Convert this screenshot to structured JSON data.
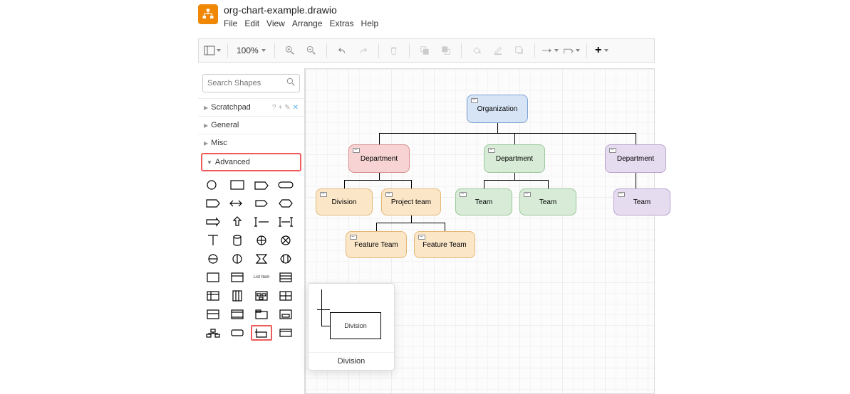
{
  "app": {
    "title": "org-chart-example.drawio"
  },
  "menu": {
    "items": [
      "File",
      "Edit",
      "View",
      "Arrange",
      "Extras",
      "Help"
    ]
  },
  "toolbar": {
    "zoom": "100%"
  },
  "search": {
    "placeholder": "Search Shapes"
  },
  "sections": {
    "scratchpad": "Scratchpad",
    "general": "General",
    "misc": "Misc",
    "advanced": "Advanced"
  },
  "nodes": {
    "org": "Organization",
    "dept1": "Department",
    "dept2": "Department",
    "dept3": "Department",
    "div": "Division",
    "proj": "Project team",
    "team1": "Team",
    "team2": "Team",
    "team3": "Team",
    "ft1": "Feature Team",
    "ft2": "Feature Team"
  },
  "shape_list_item": "List Item",
  "preview": {
    "label_in_box": "Division",
    "caption": "Division"
  }
}
